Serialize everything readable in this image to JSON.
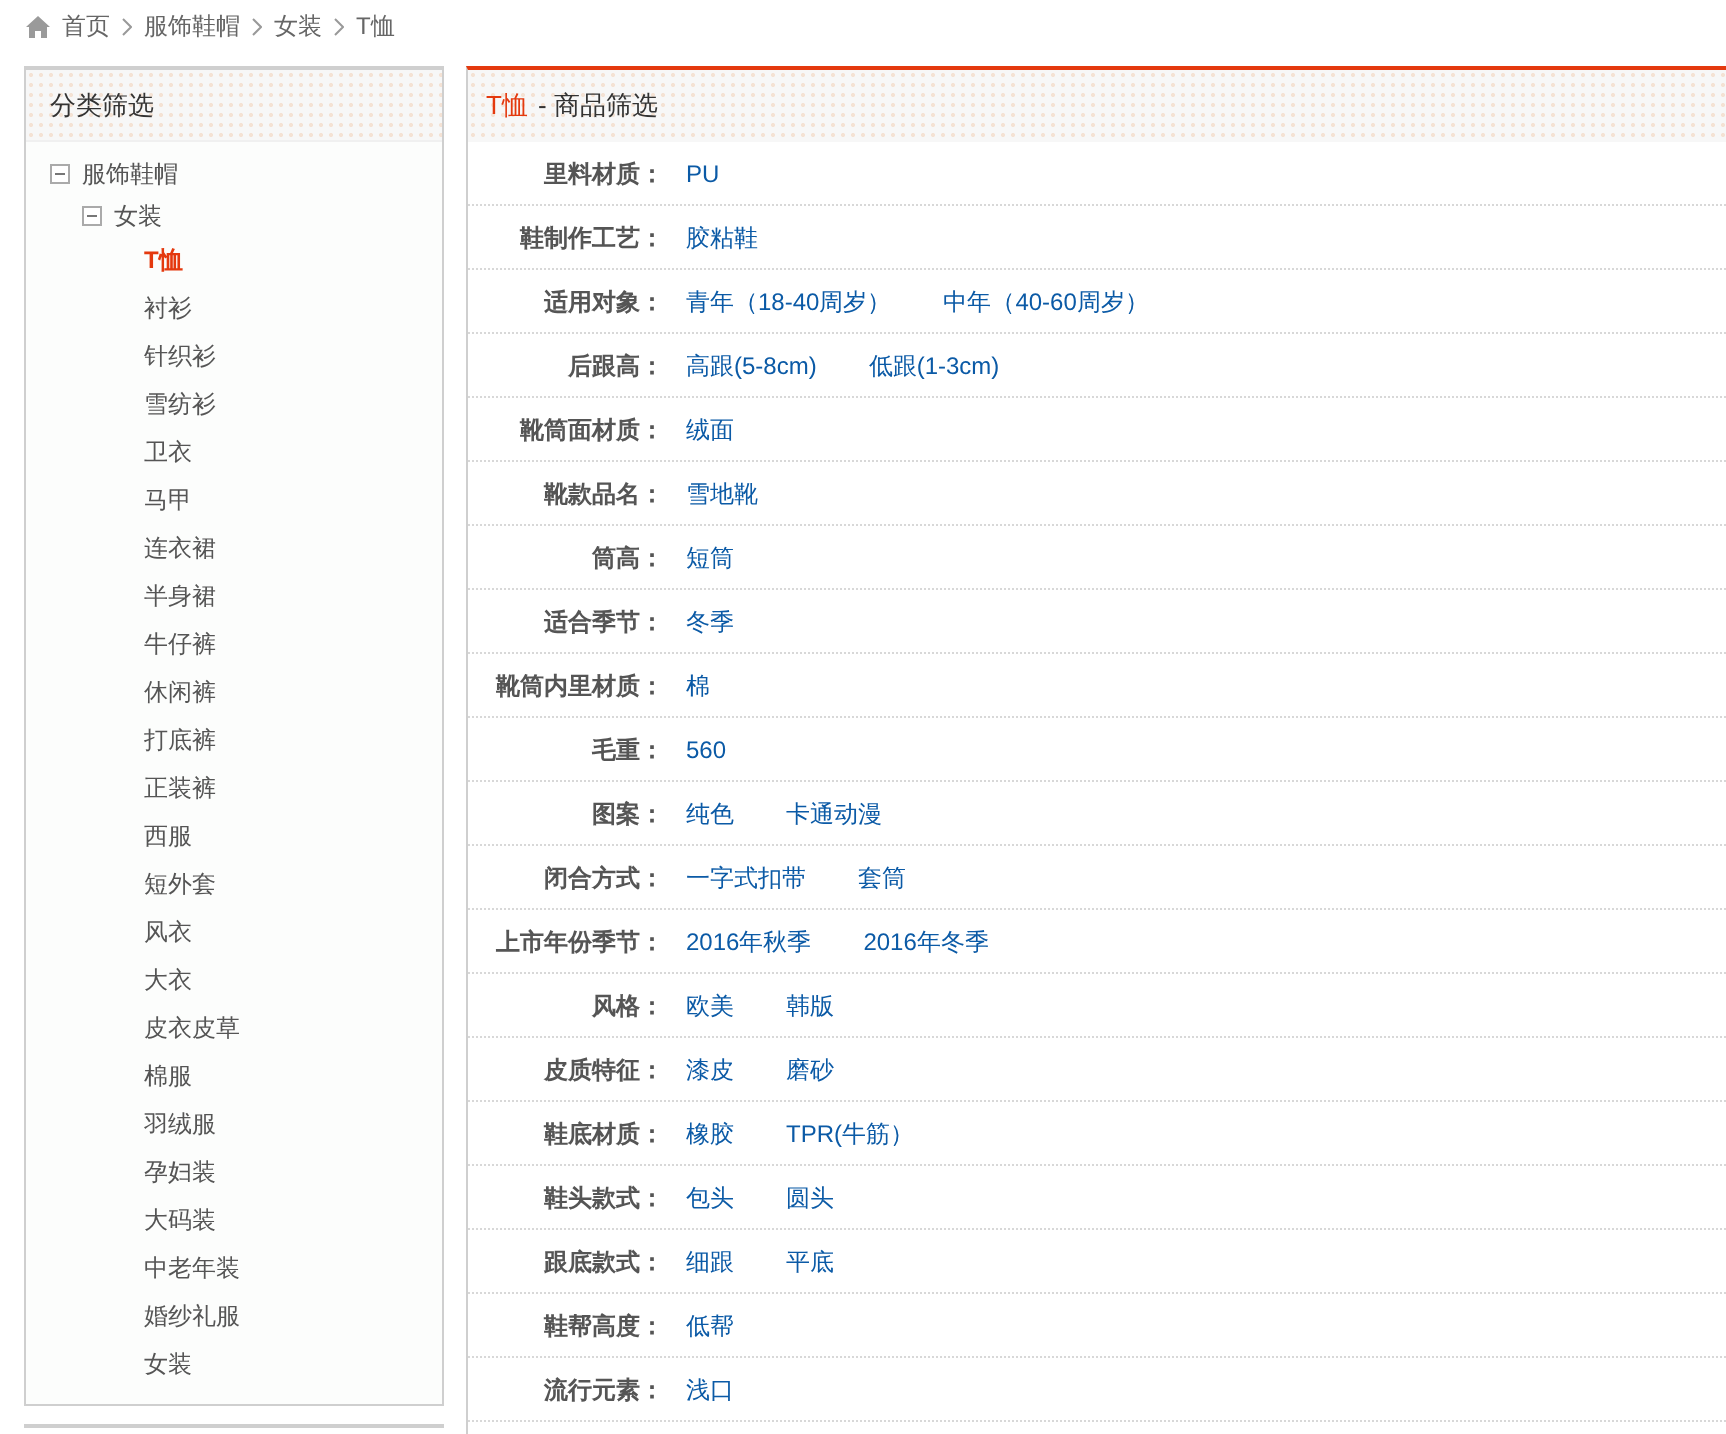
{
  "breadcrumb": [
    {
      "label": "首页"
    },
    {
      "label": "服饰鞋帽"
    },
    {
      "label": "女装"
    },
    {
      "label": "T恤"
    }
  ],
  "category_panel": {
    "title": "分类筛选",
    "tree": [
      {
        "label": "服饰鞋帽",
        "selected": false,
        "expanded": true,
        "children": [
          {
            "label": "女装",
            "selected": false,
            "expanded": true,
            "children": [
              {
                "label": "T恤",
                "selected": true
              },
              {
                "label": "衬衫",
                "selected": false
              },
              {
                "label": "针织衫",
                "selected": false
              },
              {
                "label": "雪纺衫",
                "selected": false
              },
              {
                "label": "卫衣",
                "selected": false
              },
              {
                "label": "马甲",
                "selected": false
              },
              {
                "label": "连衣裙",
                "selected": false
              },
              {
                "label": "半身裙",
                "selected": false
              },
              {
                "label": "牛仔裤",
                "selected": false
              },
              {
                "label": "休闲裤",
                "selected": false
              },
              {
                "label": "打底裤",
                "selected": false
              },
              {
                "label": "正装裤",
                "selected": false
              },
              {
                "label": "西服",
                "selected": false
              },
              {
                "label": "短外套",
                "selected": false
              },
              {
                "label": "风衣",
                "selected": false
              },
              {
                "label": "大衣",
                "selected": false
              },
              {
                "label": "皮衣皮草",
                "selected": false
              },
              {
                "label": "棉服",
                "selected": false
              },
              {
                "label": "羽绒服",
                "selected": false
              },
              {
                "label": "孕妇装",
                "selected": false
              },
              {
                "label": "大码装",
                "selected": false
              },
              {
                "label": "中老年装",
                "selected": false
              },
              {
                "label": "婚纱礼服",
                "selected": false
              },
              {
                "label": "女装",
                "selected": false
              }
            ]
          }
        ]
      }
    ]
  },
  "filter_panel": {
    "title_category": "T恤",
    "title_rest": "- 商品筛选",
    "rows": [
      {
        "label": "里料材质：",
        "options": [
          "PU"
        ]
      },
      {
        "label": "鞋制作工艺：",
        "options": [
          "胶粘鞋"
        ]
      },
      {
        "label": "适用对象：",
        "options": [
          "青年（18-40周岁）",
          "中年（40-60周岁）"
        ]
      },
      {
        "label": "后跟高：",
        "options": [
          "高跟(5-8cm)",
          "低跟(1-3cm)"
        ]
      },
      {
        "label": "靴筒面材质：",
        "options": [
          "绒面"
        ]
      },
      {
        "label": "靴款品名：",
        "options": [
          "雪地靴"
        ]
      },
      {
        "label": "筒高：",
        "options": [
          "短筒"
        ]
      },
      {
        "label": "适合季节：",
        "options": [
          "冬季"
        ]
      },
      {
        "label": "靴筒内里材质：",
        "options": [
          "棉"
        ]
      },
      {
        "label": "毛重：",
        "options": [
          "560"
        ]
      },
      {
        "label": "图案：",
        "options": [
          "纯色",
          "卡通动漫"
        ]
      },
      {
        "label": "闭合方式：",
        "options": [
          "一字式扣带",
          "套筒"
        ]
      },
      {
        "label": "上市年份季节：",
        "options": [
          "2016年秋季",
          "2016年冬季"
        ]
      },
      {
        "label": "风格：",
        "options": [
          "欧美",
          "韩版"
        ]
      },
      {
        "label": "皮质特征：",
        "options": [
          "漆皮",
          "磨砂"
        ]
      },
      {
        "label": "鞋底材质：",
        "options": [
          "橡胶",
          "TPR(牛筋）"
        ]
      },
      {
        "label": "鞋头款式：",
        "options": [
          "包头",
          "圆头"
        ]
      },
      {
        "label": "跟底款式：",
        "options": [
          "细跟",
          "平底"
        ]
      },
      {
        "label": "鞋帮高度：",
        "options": [
          "低帮"
        ]
      },
      {
        "label": "流行元素：",
        "options": [
          "浅口"
        ]
      }
    ]
  }
}
